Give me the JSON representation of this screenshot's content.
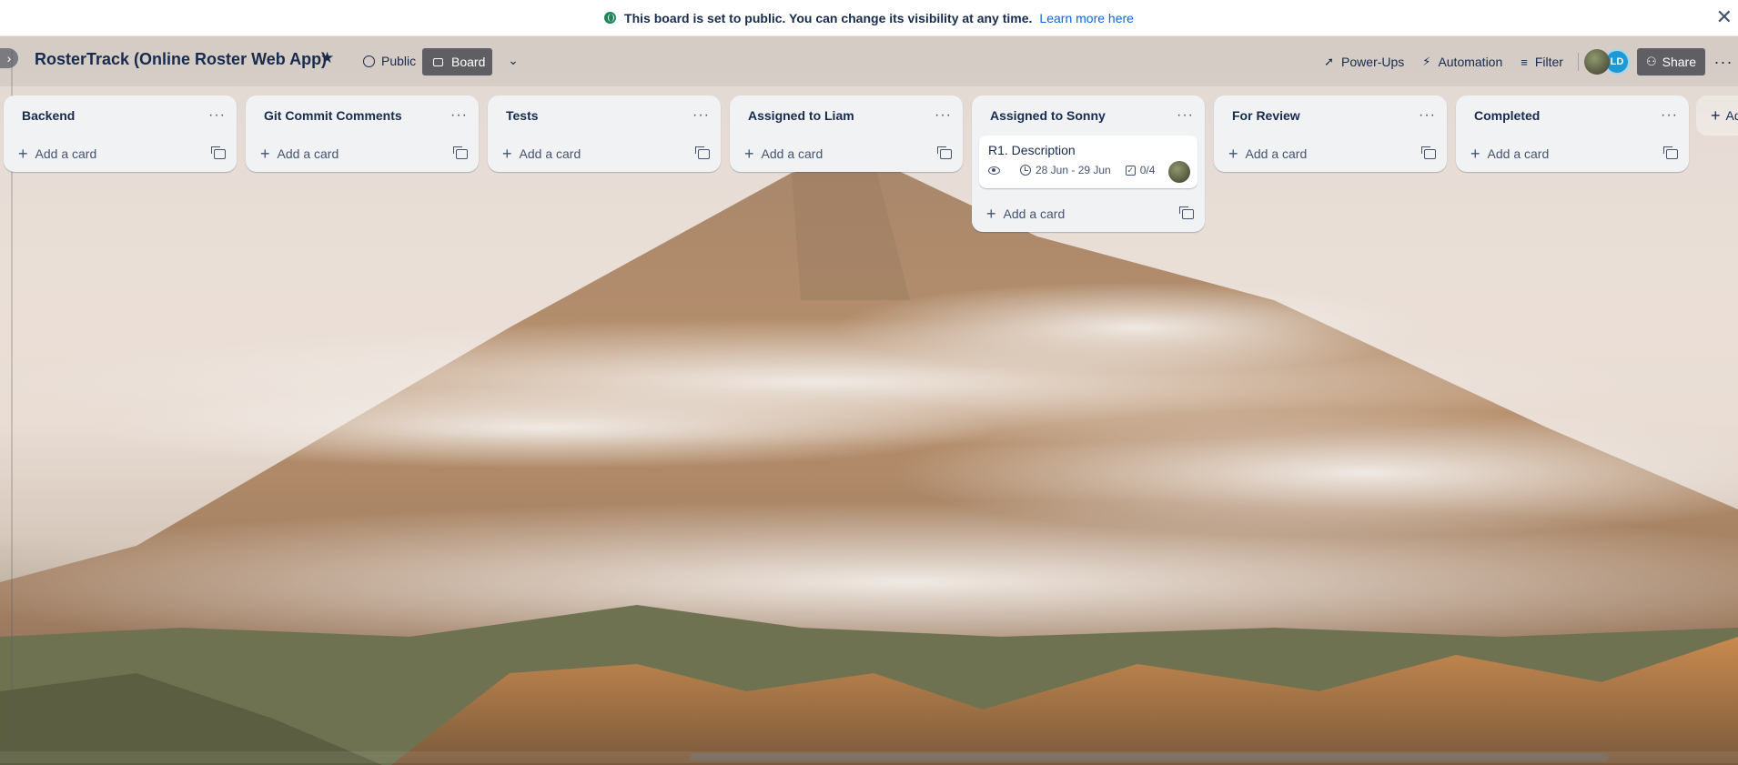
{
  "banner": {
    "message": "This board is set to public. You can change its visibility at any time.",
    "link": "Learn more here"
  },
  "board": {
    "title": "RosterTrack (Online Roster Web App)",
    "visibility": "Public",
    "view": "Board"
  },
  "header_actions": {
    "powerups": "Power-Ups",
    "automation": "Automation",
    "filter": "Filter",
    "member_initials": "LD",
    "share": "Share"
  },
  "lists": [
    {
      "title": "Backend",
      "add_label": "Add a card",
      "cards": []
    },
    {
      "title": "Git Commit Comments",
      "add_label": "Add a card",
      "cards": []
    },
    {
      "title": "Tests",
      "add_label": "Add a card",
      "cards": []
    },
    {
      "title": "Assigned to Liam",
      "add_label": "Add a card",
      "cards": []
    },
    {
      "title": "Assigned to Sonny",
      "add_label": "Add a card",
      "cards": [
        {
          "title": "R1. Description",
          "dates": "28 Jun - 29 Jun",
          "checklist": "0/4"
        }
      ]
    },
    {
      "title": "For Review",
      "add_label": "Add a card",
      "cards": []
    },
    {
      "title": "Completed",
      "add_label": "Add a card",
      "cards": []
    }
  ],
  "add_list_label": "Ad",
  "icons": {
    "banner": "globe-icon",
    "close": "close-icon",
    "star": "star-icon",
    "powerups": "rocket-icon",
    "automation": "lightning-icon",
    "filter": "filter-icon",
    "share": "person-add-icon",
    "more": "more-icon"
  }
}
